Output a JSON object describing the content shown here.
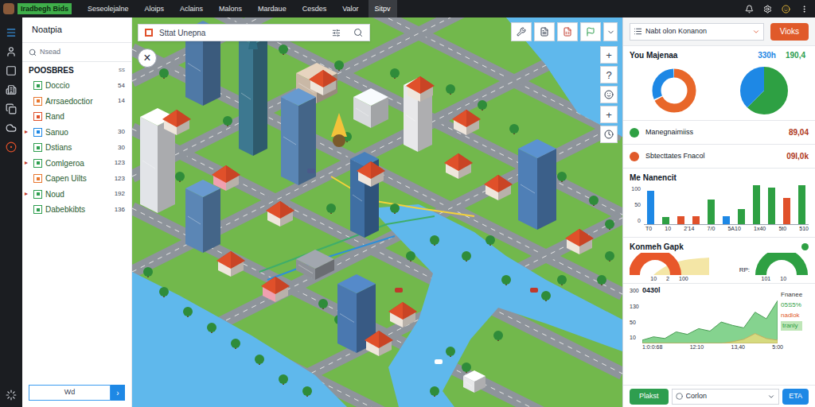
{
  "topbar": {
    "logo": "Iradbegh Bids",
    "menu": [
      {
        "label": "Seseolejalne",
        "selected": false
      },
      {
        "label": "Aloips",
        "selected": false
      },
      {
        "label": "Aclains",
        "selected": false
      },
      {
        "label": "Malons",
        "selected": false
      },
      {
        "label": "Mardaue",
        "selected": false
      },
      {
        "label": "Cesdes",
        "selected": false
      },
      {
        "label": "Valor",
        "selected": false
      },
      {
        "label": "Sitpv",
        "selected": true
      }
    ]
  },
  "sidebar": {
    "title": "Noatpia",
    "search": {
      "placeholder": "Nsead"
    },
    "section": {
      "label": "POOSBRES",
      "count": "ss"
    },
    "items": [
      {
        "label": "Doccio",
        "count": "54",
        "color": "#2e9e4f",
        "arrow": ""
      },
      {
        "label": "Arrsaedoctior",
        "count": "14",
        "color": "#e8772e",
        "arrow": ""
      },
      {
        "label": "Rand",
        "count": "",
        "color": "#e0502a",
        "arrow": ""
      },
      {
        "label": "Sanuo",
        "count": "30",
        "color": "#1e88e5",
        "arrow": "▸"
      },
      {
        "label": "Dstians",
        "count": "30",
        "color": "#2e9e4f",
        "arrow": ""
      },
      {
        "label": "Comlgeroa",
        "count": "123",
        "color": "#2e9e4f",
        "arrow": "▸"
      },
      {
        "label": "Capen Uilts",
        "count": "123",
        "color": "#e8772e",
        "arrow": ""
      },
      {
        "label": "Noud",
        "count": "192",
        "color": "#2e9e4f",
        "arrow": "▸"
      },
      {
        "label": "Dabebkibts",
        "count": "136",
        "color": "#2e9e4f",
        "arrow": ""
      }
    ],
    "footer": {
      "input": "Wd",
      "button": "›"
    }
  },
  "map": {
    "search": {
      "placeholder": "Sttat Unepna"
    },
    "close": "×",
    "controls": [
      {
        "kind": "text",
        "label": "+"
      },
      {
        "kind": "text",
        "label": "?"
      },
      {
        "kind": "smile"
      },
      {
        "kind": "text",
        "label": "+"
      },
      {
        "kind": "clock"
      }
    ]
  },
  "panel": {
    "dropdown": "Nabt olon Konanon",
    "button": "Vioks",
    "summary": {
      "title": "You Majenaa",
      "values": [
        {
          "text": "330h",
          "color": "#1e88e5"
        },
        {
          "text": "190,4",
          "color": "#2e9e4f"
        }
      ],
      "donuts": [
        {
          "values": [
            68,
            32
          ],
          "colors": [
            "#e8672a",
            "#1e88e5"
          ]
        },
        {
          "values": [
            62,
            38
          ],
          "colors": [
            "#2ea043",
            "#1e88e5"
          ]
        }
      ]
    },
    "stats": [
      {
        "label": "Manegnaimiiss",
        "value": "89,04",
        "color": "#2ea043"
      },
      {
        "label": "Sbtecttates Fnacol",
        "value": "09l,0k",
        "color": "#e05a2a"
      }
    ],
    "bar_chart": {
      "title": "Me Nanencit",
      "y_ticks": [
        "100",
        "50",
        "0"
      ],
      "x_labels": [
        "T0",
        "10",
        "2'14",
        "7/0",
        "5A10",
        "1x40",
        "5t0",
        "510"
      ],
      "bars": [
        {
          "value": 130,
          "color": "#1e88e5"
        },
        {
          "value": 28,
          "color": "#2ea043"
        },
        {
          "value": 30,
          "color": "#e0502a"
        },
        {
          "value": 30,
          "color": "#e0502a"
        },
        {
          "value": 95,
          "color": "#2ea043"
        },
        {
          "value": 32,
          "color": "#1e88e5"
        },
        {
          "value": 58,
          "color": "#2ea043"
        },
        {
          "value": 150,
          "color": "#2ea043"
        },
        {
          "value": 140,
          "color": "#2ea043"
        },
        {
          "value": 100,
          "color": "#e0502a"
        },
        {
          "value": 150,
          "color": "#2ea043"
        }
      ]
    },
    "gauges": {
      "title": "Konmeh Gapk",
      "status_color": "#2ea043",
      "items": [
        {
          "label": "",
          "level": 1,
          "color": "#e8572a",
          "ticks": [
            "10",
            "2",
            "100"
          ]
        },
        {
          "label": "RP:",
          "level": 1,
          "color": "#2ea043",
          "ticks": [
            "101",
            "10"
          ]
        }
      ]
    },
    "area_chart": {
      "title": "0430l",
      "y_ticks": [
        "300",
        "130",
        "50",
        "10"
      ],
      "x_labels": [
        "1:0:0:68",
        "12:10",
        "13,40",
        "5:00"
      ],
      "series": [
        {
          "values": [
            20,
            40,
            30,
            70,
            55,
            90,
            75,
            130,
            110,
            95,
            190,
            150,
            260
          ],
          "color": "#5cc46a"
        },
        {
          "values": [
            0,
            0,
            0,
            0,
            0,
            0,
            0,
            0,
            10,
            25,
            60,
            30,
            20
          ],
          "color": "#f2dc7a"
        }
      ],
      "legend": [
        {
          "label": "Fnanee",
          "color": "#333333"
        },
        {
          "label": "05S5%",
          "color": "#2ea043"
        },
        {
          "label": "nadlok",
          "color": "#e05a2a"
        },
        {
          "label": "tranly",
          "color": "#2ea043"
        }
      ]
    },
    "bottom": {
      "primary": "Plakst",
      "select": "Corlon",
      "secondary": "ETA"
    }
  }
}
